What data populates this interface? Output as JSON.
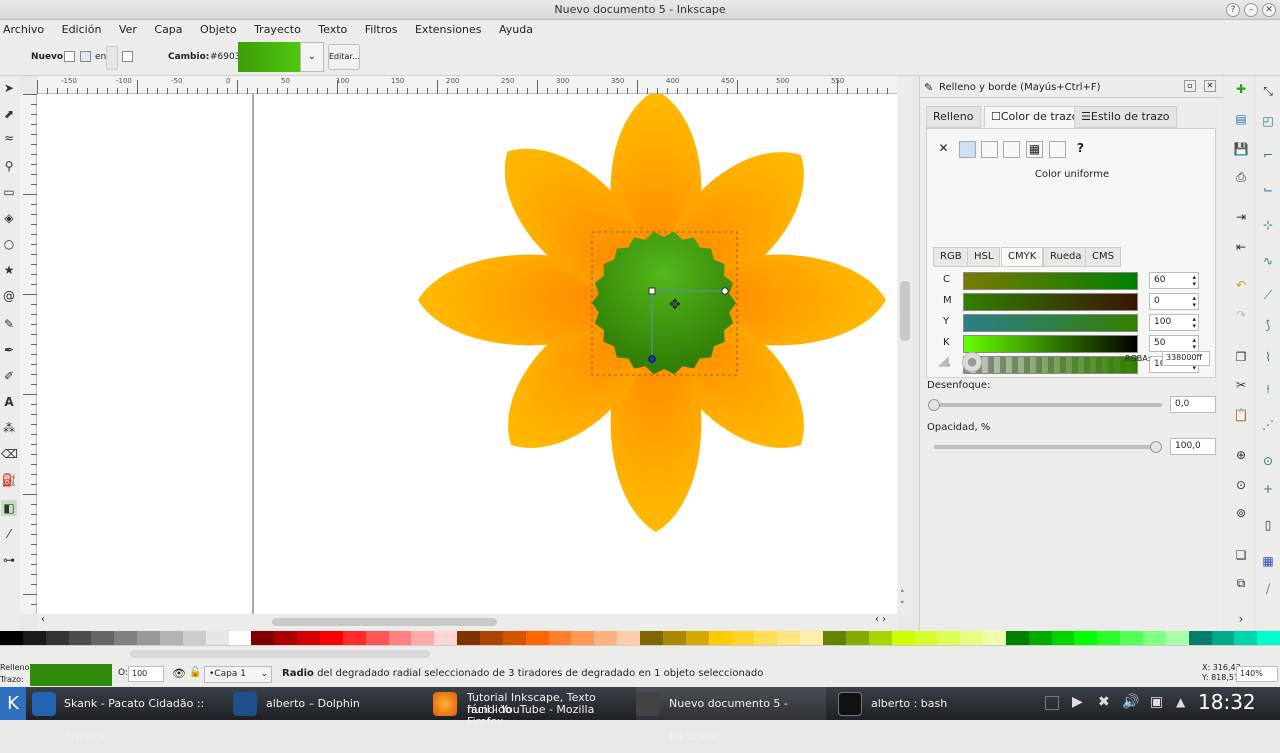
{
  "window": {
    "title": "Nuevo documento 5 - Inkscape"
  },
  "menu": [
    "Archivo",
    "Edición",
    "Ver",
    "Capa",
    "Objeto",
    "Trayecto",
    "Texto",
    "Filtros",
    "Extensiones",
    "Ayuda"
  ],
  "controls": {
    "new_label": "Nuevo:",
    "on_label": "en",
    "change_label": "Cambio:",
    "gradient_id": "#6903",
    "edit_label": "Editar..."
  },
  "ruler": {
    "ticks": [
      "-150",
      "-100",
      "-50",
      "0",
      "50",
      "100",
      "150",
      "200",
      "250",
      "300",
      "350",
      "400",
      "450",
      "500",
      "550"
    ]
  },
  "panel": {
    "title": "Relleno y borde (Mayús+Ctrl+F)",
    "tabs": [
      "Relleno",
      "Color de trazo",
      "Estilo de trazo"
    ],
    "paint_mode_label": "Color uniforme",
    "color_tabs": [
      "RGB",
      "HSL",
      "CMYK",
      "Rueda",
      "CMS"
    ],
    "active_color_tab": "CMYK",
    "channels": [
      {
        "label": "C",
        "value": "60"
      },
      {
        "label": "M",
        "value": "0"
      },
      {
        "label": "Y",
        "value": "100"
      },
      {
        "label": "K",
        "value": "50"
      },
      {
        "label": "A",
        "value": "100"
      }
    ],
    "rgba_label": "RGBA:",
    "rgba_value": "338000ff",
    "blur_label": "Desenfoque:",
    "blur_value": "0,0",
    "blur_level": 0,
    "opacity_label": "Opacidad, %",
    "opacity_value": "100,0",
    "opacity_level": 1
  },
  "status": {
    "fill_label": "Relleno:",
    "stroke_label": "Trazo:",
    "opacity_prefix": "O:",
    "opacity_value": "100",
    "layer": "•Capa 1",
    "message_bold": "Radio",
    "message": " del degradado radial seleccionado de 3 tiradores de degradado en 1 objeto seleccionado",
    "coord_x": "X: 316,43",
    "coord_y": "Y: 818,57",
    "zoom": "140%"
  },
  "colors": {
    "petal_light": "#ffb700",
    "petal_dark": "#ff7f00",
    "center": "#338000",
    "center_light": "#4fb81a"
  },
  "taskbar": {
    "items": [
      "Skank - Pacato Cidadão :: Amarok",
      "alberto – Dolphin",
      "Tutorial Inkscape, Texto hundido fácil - YouTube - Mozilla Firefox",
      "Nuevo documento 5 - Inkscape",
      "alberto : bash"
    ],
    "firefox_line1": "Tutorial Inkscape, Texto hundido",
    "firefox_line2": "fácil - YouTube - Mozilla Firefox",
    "clock": "18:32"
  }
}
